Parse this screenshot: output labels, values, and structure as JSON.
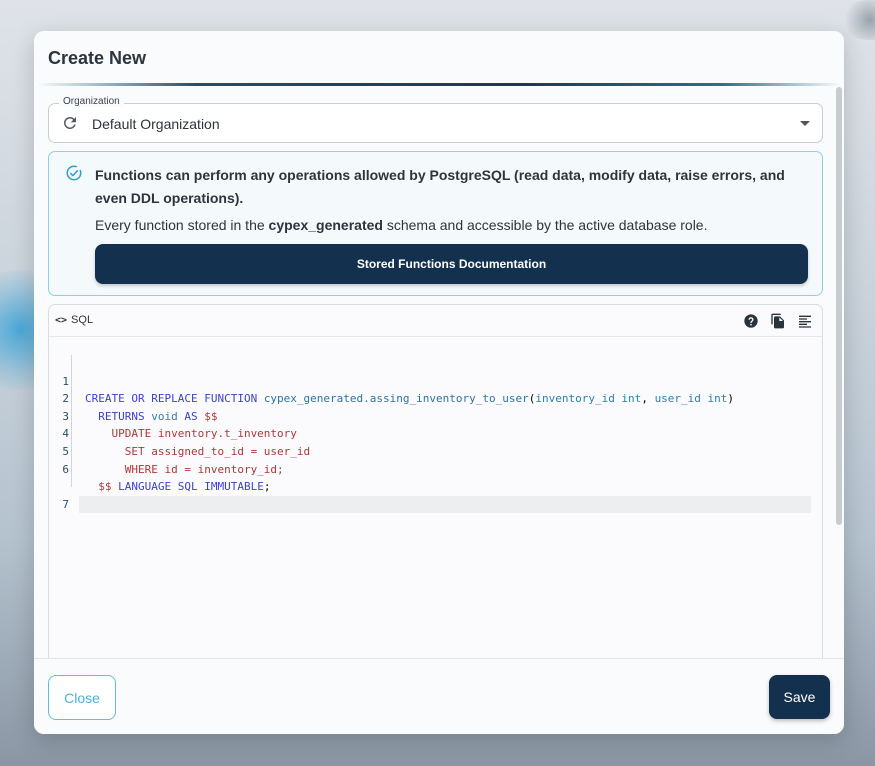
{
  "dialog": {
    "title": "Create New"
  },
  "organization": {
    "label": "Organization",
    "value": "Default Organization"
  },
  "info": {
    "main_text": "Functions can perform any operations allowed by PostgreSQL (read data, modify data, raise errors, and even DDL operations).",
    "sub_text_before": "Every function stored in the ",
    "sub_text_bold": "cypex_generated",
    "sub_text_after": " schema and accessible by the active database role.",
    "doc_button_label": "Stored Functions Documentation"
  },
  "editor": {
    "mode_label": "SQL",
    "line_numbers": [
      "1",
      "2",
      "3",
      "4",
      "5",
      "6",
      "7"
    ],
    "code": {
      "l1": {
        "kw1": "CREATE OR REPLACE FUNCTION ",
        "fn": "cypex_generated.assing_inventory_to_user",
        "p1": "(",
        "a1": "inventory_id int",
        "c1": ", ",
        "a2": "user_id int",
        "p2": ")"
      },
      "l2": {
        "indent": "  ",
        "kw1": "RETURNS ",
        "tp": "void",
        "kw2": " AS ",
        "rd": "$$"
      },
      "l3": "    UPDATE inventory.t_inventory",
      "l4": "      SET assigned_to_id = user_id",
      "l5": "      WHERE id = inventory_id;",
      "l6": {
        "indent": "  ",
        "rd": "$$ ",
        "kw": "LANGUAGE SQL IMMUTABLE",
        "end": ";"
      },
      "l7": ""
    }
  },
  "footer": {
    "close_label": "Close",
    "save_label": "Save"
  },
  "colors": {
    "primary_dark": "#14304f",
    "accent_cyan": "#47b4d6",
    "keyword": "#3b3fcf",
    "string_red": "#b03636"
  },
  "icons": {
    "org_refresh": "refresh-icon",
    "info": "check-circle-icon",
    "help": "help-circle-icon",
    "copy": "copy-icon",
    "format": "format-align-icon",
    "caret": "chevron-down-icon",
    "code": "code-icon"
  }
}
